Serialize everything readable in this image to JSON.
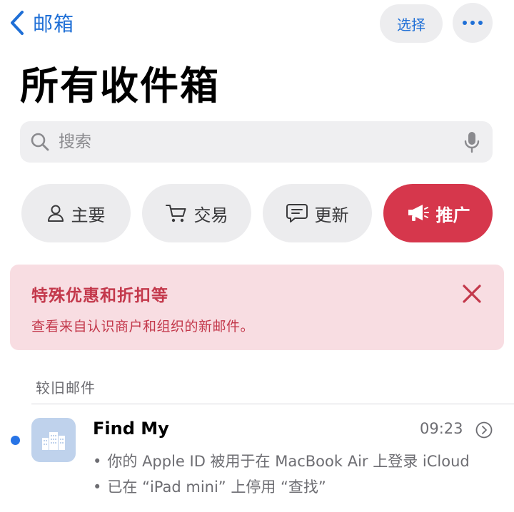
{
  "nav": {
    "back_label": "邮箱",
    "select_label": "选择"
  },
  "title": "所有收件箱",
  "search": {
    "placeholder": "搜索"
  },
  "categories": [
    {
      "label": "主要",
      "icon": "person-icon",
      "active": false
    },
    {
      "label": "交易",
      "icon": "cart-icon",
      "active": false
    },
    {
      "label": "更新",
      "icon": "message-icon",
      "active": false
    },
    {
      "label": "推广",
      "icon": "megaphone-icon",
      "active": true
    }
  ],
  "banner": {
    "title": "特殊优惠和折扣等",
    "subtitle": "查看来自认识商户和组织的新邮件。"
  },
  "section_header": "较旧邮件",
  "mail": {
    "sender": "Find My",
    "time": "09:23",
    "unread": true,
    "preview_lines": [
      "你的 Apple ID 被用于在 MacBook Air 上登录 iCloud",
      "已在 “iPad mini” 上停用 “查找”"
    ],
    "bullet": "•"
  },
  "colors": {
    "accent": "#1f6fd6",
    "promo": "#d6374c",
    "promo_text": "#c3384b",
    "banner_bg": "#f8dde2",
    "unread_dot": "#2774e6"
  }
}
